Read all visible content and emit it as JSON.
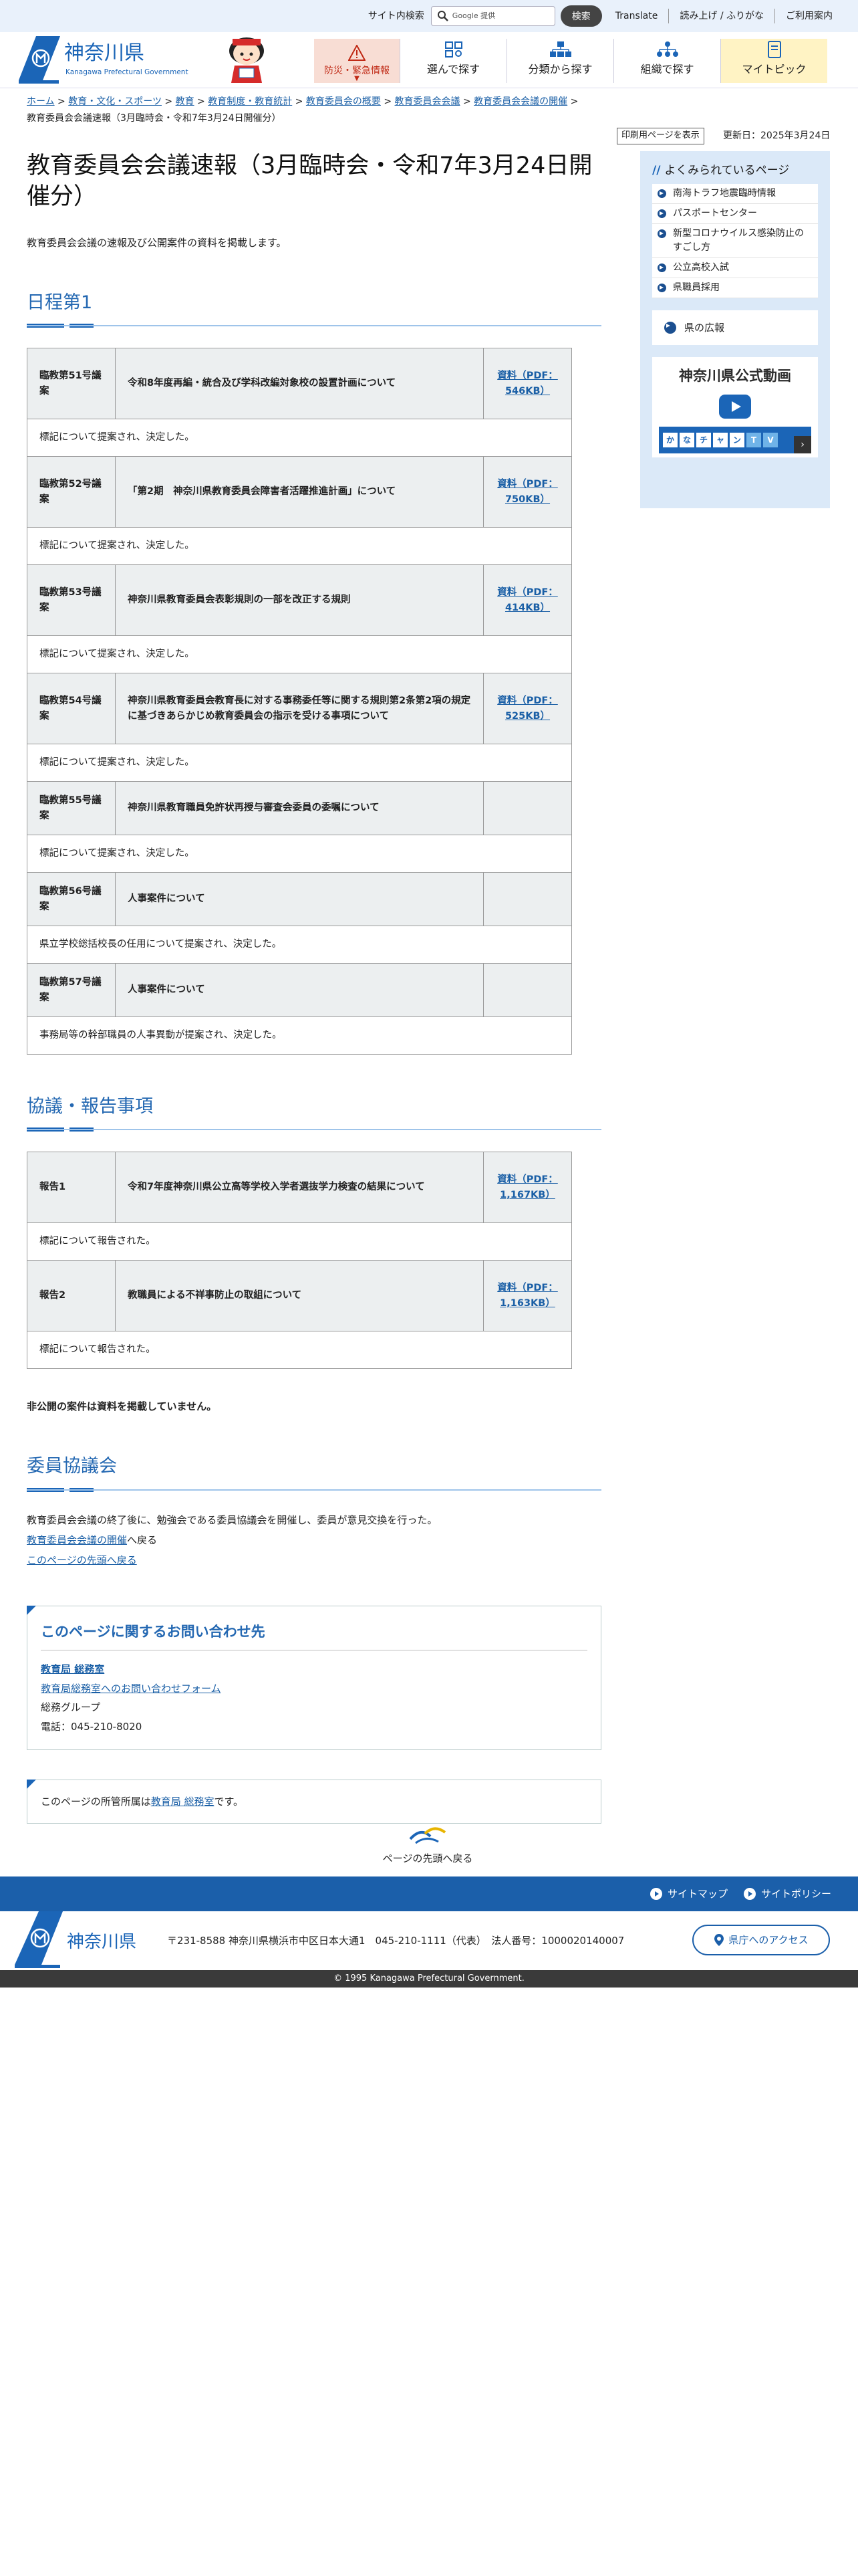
{
  "utility": {
    "search_label": "サイト内検索",
    "search_placeholder": "Google 提供",
    "search_button": "検索",
    "links": [
      "Translate",
      "読み上げ / ふりがな",
      "ご利用案内"
    ]
  },
  "header": {
    "logo_name": "神奈川県",
    "logo_sub": "Kanagawa Prefectural Government",
    "nav": [
      {
        "label": "防災・緊急情報",
        "icon": "warning-icon"
      },
      {
        "label": "選んで探す",
        "icon": "grid-icon"
      },
      {
        "label": "分類から探す",
        "icon": "category-icon"
      },
      {
        "label": "組織で探す",
        "icon": "org-icon"
      },
      {
        "label": "マイトピック",
        "icon": "book-icon"
      }
    ]
  },
  "breadcrumb": {
    "items": [
      "ホーム",
      "教育・文化・スポーツ",
      "教育",
      "教育制度・教育統計",
      "教育委員会の概要",
      "教育委員会会議",
      "教育委員会会議の開催"
    ],
    "current": "教育委員会会議速報（3月臨時会・令和7年3月24日開催分）"
  },
  "print_button": "印刷用ページを表示",
  "updated": "更新日：2025年3月24日",
  "page": {
    "title": "教育委員会会議速報（3月臨時会・令和7年3月24日開催分）",
    "lead": "教育委員会会議の速報及び公開案件の資料を掲載します。"
  },
  "section1": {
    "heading": "日程第1",
    "rows": [
      {
        "no": "臨教第51号議案",
        "title": "令和8年度再編・統合及び学科改編対象校の設置計画について",
        "doc": "資料（PDF：546KB）",
        "note": "標記について提案され、決定した。"
      },
      {
        "no": "臨教第52号議案",
        "title": "「第2期　神奈川県教育委員会障害者活躍推進計画」について",
        "doc": "資料（PDF：750KB）",
        "note": "標記について提案され、決定した。"
      },
      {
        "no": "臨教第53号議案",
        "title": "神奈川県教育委員会表彰規則の一部を改正する規則",
        "doc": "資料（PDF：414KB）",
        "note": "標記について提案され、決定した。"
      },
      {
        "no": "臨教第54号議案",
        "title": "神奈川県教育委員会教育長に対する事務委任等に関する規則第2条第2項の規定に基づきあらかじめ教育委員会の指示を受ける事項について",
        "doc": "資料（PDF：525KB）",
        "note": "標記について提案され、決定した。"
      },
      {
        "no": "臨教第55号議案",
        "title": "神奈川県教育職員免許状再授与審査会委員の委嘱について",
        "doc": "",
        "note": "標記について提案され、決定した。"
      },
      {
        "no": "臨教第56号議案",
        "title": "人事案件について",
        "doc": "",
        "note": "県立学校総括校長の任用について提案され、決定した。"
      },
      {
        "no": "臨教第57号議案",
        "title": "人事案件について",
        "doc": "",
        "note": "事務局等の幹部職員の人事異動が提案され、決定した。"
      }
    ]
  },
  "section2": {
    "heading": "協議・報告事項",
    "rows": [
      {
        "no": "報告1",
        "title": "令和7年度神奈川県公立高等学校入学者選抜学力検査の結果について",
        "doc": "資料（PDF：1,167KB）",
        "note": "標記について報告された。"
      },
      {
        "no": "報告2",
        "title": "教職員による不祥事防止の取組について",
        "doc": "資料（PDF：1,163KB）",
        "note": "標記について報告された。"
      }
    ]
  },
  "nonpublic": "非公開の案件は資料を掲載していません。",
  "section3": {
    "heading": "委員協議会",
    "text": "教育委員会会議の終了後に、勉強会である委員協議会を開催し、委員が意見交換を行った。",
    "back_link": "教育委員会会議の開催",
    "back_suffix": "へ戻る",
    "top_link": "このページの先頭へ戻る"
  },
  "contact": {
    "heading": "このページに関するお問い合わせ先",
    "dept": "教育局 総務室",
    "form": "教育局総務室へのお問い合わせフォーム",
    "group": "総務グループ",
    "tel": "電話：045-210-8020"
  },
  "owner": {
    "prefix": "このページの所管所属は",
    "dept": "教育局 総務室",
    "suffix": "です。"
  },
  "sidebar": {
    "heading": "よくみられているページ",
    "items": [
      "南海トラフ地震臨時情報",
      "パスポートセンター",
      "新型コロナウイルス感染防止のすごし方",
      "公立高校入試",
      "県職員採用"
    ],
    "koho": "県の広報",
    "video_title": "神奈川県公式動画",
    "kana_tv": [
      "か",
      "な",
      "チ",
      "ャ",
      "ン",
      "T",
      "V"
    ]
  },
  "pagetop": "ページの先頭へ戻る",
  "footer": {
    "sitemap": "サイトマップ",
    "policy": "サイトポリシー",
    "logo_name": "神奈川県",
    "address": "〒231-8588 神奈川県横浜市中区日本大通1　045-210-1111（代表）　法人番号：1000020140007",
    "access": "県庁へのアクセス",
    "copyright": "© 1995 Kanagawa Prefectural Government."
  },
  "colors": {
    "brand": "#1b65b7",
    "heading": "#2468b2",
    "disaster_bg": "#f8ddd4",
    "mytopic_bg": "#fff3c4"
  }
}
